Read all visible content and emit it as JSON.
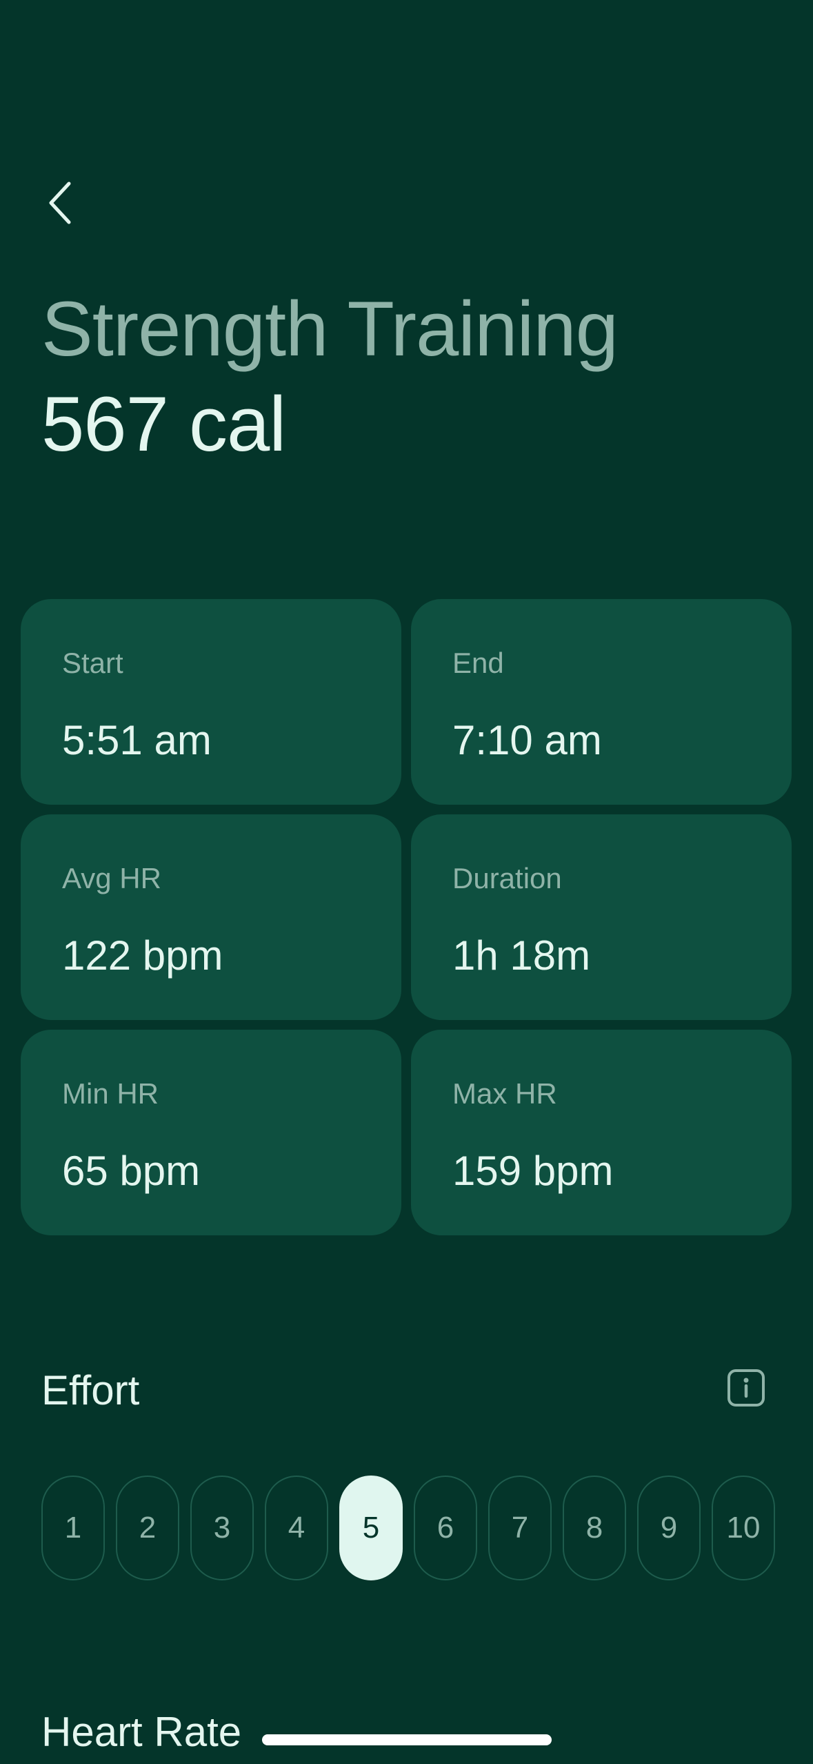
{
  "header": {
    "back_icon": "chevron-left-icon",
    "title": "Strength Training",
    "calories": "567 cal"
  },
  "stats": [
    {
      "label": "Start",
      "value": "5:51 am"
    },
    {
      "label": "End",
      "value": "7:10 am"
    },
    {
      "label": "Avg HR",
      "value": "122 bpm"
    },
    {
      "label": "Duration",
      "value": "1h 18m"
    },
    {
      "label": "Min HR",
      "value": "65 bpm"
    },
    {
      "label": "Max HR",
      "value": "159 bpm"
    }
  ],
  "effort": {
    "label": "Effort",
    "info_icon": "info-icon",
    "options": [
      "1",
      "2",
      "3",
      "4",
      "5",
      "6",
      "7",
      "8",
      "9",
      "10"
    ],
    "selected": "5"
  },
  "heart_rate": {
    "label": "Heart Rate"
  },
  "colors": {
    "background": "#04352a",
    "card": "#0e5040",
    "text_primary": "#e4f6ef",
    "text_secondary": "#8fb3a8",
    "selected_pill": "#e0f6ef"
  }
}
